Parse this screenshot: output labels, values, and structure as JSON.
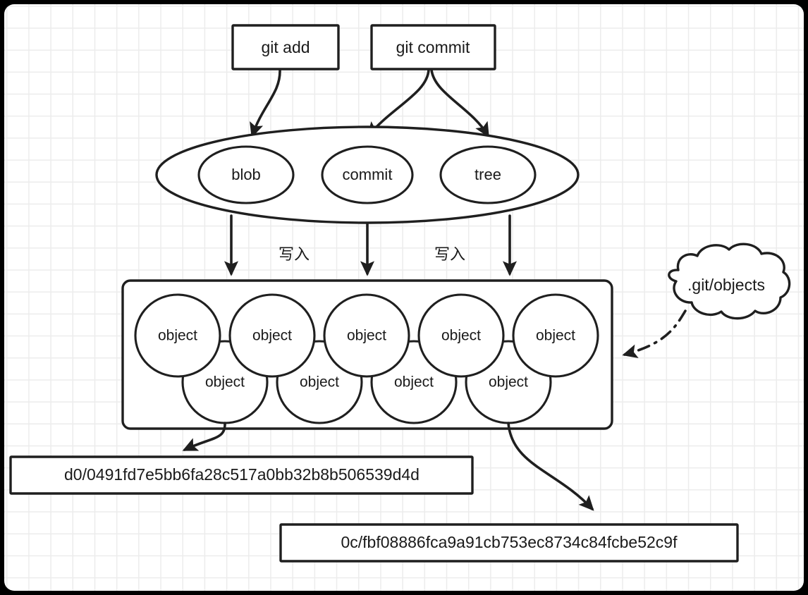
{
  "diagram": {
    "title": "git object storage flow",
    "background": {
      "page_color": "#000000",
      "board_color": "#ffffff",
      "grid_color": "#ececec",
      "ink_color": "#1f1f1f"
    },
    "commands": [
      {
        "id": "git-add",
        "label": "git add"
      },
      {
        "id": "git-commit",
        "label": "git commit"
      }
    ],
    "object_types_group": {
      "id": "object-types-ellipse",
      "shape": "ellipse",
      "items": [
        {
          "id": "blob",
          "label": "blob"
        },
        {
          "id": "commit",
          "label": "commit"
        },
        {
          "id": "tree",
          "label": "tree"
        }
      ]
    },
    "edge_labels": [
      {
        "id": "write-left",
        "label": "写入"
      },
      {
        "id": "write-right",
        "label": "写入"
      }
    ],
    "objects_store": {
      "id": "objects-box",
      "row_top": [
        {
          "label": "object"
        },
        {
          "label": "object"
        },
        {
          "label": "object"
        },
        {
          "label": "object"
        },
        {
          "label": "object"
        }
      ],
      "row_bottom": [
        {
          "label": "object"
        },
        {
          "label": "object"
        },
        {
          "label": "object"
        },
        {
          "label": "object"
        }
      ]
    },
    "callout": {
      "id": "git-objects-cloud",
      "shape": "cloud",
      "label": ".git/objects"
    },
    "hash_paths": [
      {
        "id": "hash-path-1",
        "label": "d0/0491fd7e5bb6fa28c517a0bb32b8b506539d4d"
      },
      {
        "id": "hash-path-2",
        "label": "0c/fbf08886fca9a91cb753ec8734c84fcbe52c9f"
      }
    ]
  }
}
